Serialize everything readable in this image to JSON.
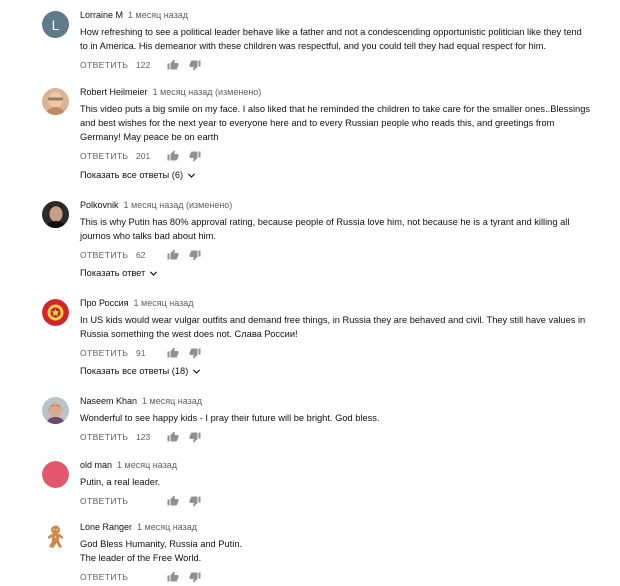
{
  "labels": {
    "reply": "ОТВЕТИТЬ"
  },
  "comments": [
    {
      "author": "Lorraine M",
      "time": "1 месяц назад",
      "avatar_letter": "L",
      "text": "How refreshing to see a political leader behave like a father and not a condescending opportunistic politician like they tend to in America. His demeanor with these children was respectful, and you could tell they had equal respect for him.",
      "likes": "122"
    },
    {
      "author": "Robert Heilmeier",
      "time": "1 месяц назад (изменено)",
      "text": "This video puts a big smile on my face. I also liked that he reminded the children to take care for the smaller ones..Blessings and best wishes for the next year to everyone here and to every Russian people who reads this, and greetings from Germany! May peace be on earth",
      "likes": "201",
      "thread": "Показать все ответы (6)"
    },
    {
      "author": "Polkovnik",
      "time": "1 месяц назад (изменено)",
      "text": "This is why Putin has 80% approval rating, because people of Russia love him, not because he is a tyrant and killing all journos who talks bad about him.",
      "likes": "62",
      "thread": "Показать ответ"
    },
    {
      "author": "Про Россия",
      "time": "1 месяц назад",
      "text": "In US kids would wear vulgar outfits and demand free things, in Russia they are behaved and civil. They still have values in Russia something the west does not. Слава России!",
      "likes": "91",
      "thread": "Показать все ответы (18)"
    },
    {
      "author": "Naseem Khan",
      "time": "1 месяц назад",
      "text": "Wonderful to see happy kids - I pray their future will be bright.  God bless.",
      "likes": "123"
    },
    {
      "author": "old man",
      "time": "1 месяц назад",
      "text": "Putin, a real leader.",
      "likes": ""
    },
    {
      "author": "Lone Ranger",
      "time": "1 месяц назад",
      "text": "God Bless Humanity, Russia and Putin.\nThe leader of the Free World.",
      "likes": "",
      "text_lines": [
        "God Bless Humanity, Russia and Putin.",
        "The leader of the Free World."
      ]
    }
  ]
}
